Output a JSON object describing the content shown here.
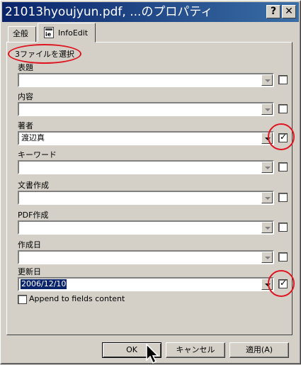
{
  "window": {
    "title": "21013hyoujyun.pdf, ...のプロパティ",
    "help_symbol": "?",
    "close_symbol": "✕"
  },
  "tabs": [
    {
      "label": "全般"
    },
    {
      "label": "InfoEdit",
      "icon": "ie-icon"
    }
  ],
  "selection_note": "3ファイルを選択",
  "fields": [
    {
      "label": "表題",
      "value": "",
      "checked": false
    },
    {
      "label": "内容",
      "value": "",
      "checked": false
    },
    {
      "label": "著者",
      "value": "渡辺真",
      "checked": true
    },
    {
      "label": "キーワード",
      "value": "",
      "checked": false
    },
    {
      "label": "文書作成",
      "value": "",
      "checked": false
    },
    {
      "label": "PDF作成",
      "value": "",
      "checked": false
    },
    {
      "label": "作成日",
      "value": "",
      "checked": false
    },
    {
      "label": "更新日",
      "value": "2006/12/10",
      "checked": true
    }
  ],
  "append_option": {
    "label": "Append to fields content",
    "checked": false
  },
  "buttons": {
    "ok": "OK",
    "cancel": "キャンセル",
    "apply": "適用(A)"
  },
  "colors": {
    "annotation": "#e0141e",
    "titlebar": "#0a246a",
    "face": "#d4d0c8"
  }
}
